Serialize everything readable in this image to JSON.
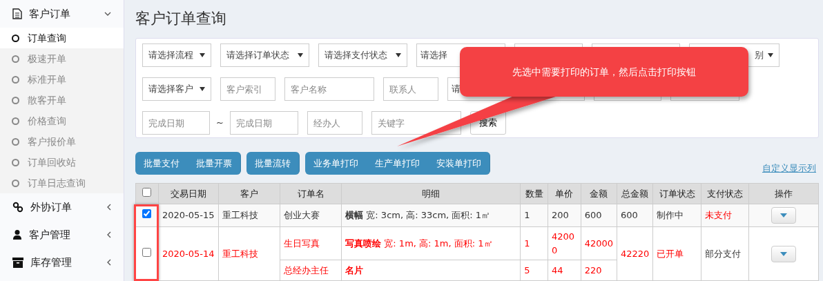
{
  "sidebar": {
    "groups": [
      {
        "label": "客户订单",
        "expanded": true,
        "items": [
          {
            "label": "订单查询",
            "selected": true
          },
          {
            "label": "极速开单",
            "selected": false
          },
          {
            "label": "标准开单",
            "selected": false
          },
          {
            "label": "散客开单",
            "selected": false
          },
          {
            "label": "价格查询",
            "selected": false
          },
          {
            "label": "客户报价单",
            "selected": false
          },
          {
            "label": "订单回收站",
            "selected": false
          },
          {
            "label": "订单日志查询",
            "selected": false
          }
        ]
      },
      {
        "label": "外协订单",
        "expanded": false
      },
      {
        "label": "客户管理",
        "expanded": false
      },
      {
        "label": "库存管理",
        "expanded": false
      }
    ]
  },
  "page_title": "客户订单查询",
  "filters": [
    [
      {
        "kind": "select",
        "text": "请选择流程"
      },
      {
        "kind": "select",
        "text": "请选择订单状态"
      },
      {
        "kind": "select",
        "text": "请选择支付状态"
      },
      {
        "kind": "box",
        "text": "请选择"
      },
      {
        "kind": "box"
      },
      {
        "kind": "box"
      },
      {
        "kind": "tail-select",
        "text": "别"
      }
    ],
    [
      {
        "kind": "select",
        "text": "请选择客户"
      },
      {
        "kind": "input",
        "placeholder": "客户索引"
      },
      {
        "kind": "input",
        "placeholder": "客户名称"
      },
      {
        "kind": "input",
        "placeholder": "联系人"
      },
      {
        "kind": "box",
        "text": "请"
      },
      {
        "kind": "box"
      },
      {
        "kind": "box"
      }
    ],
    [
      {
        "kind": "input",
        "placeholder": "完成日期"
      },
      {
        "kind": "separator",
        "text": "~"
      },
      {
        "kind": "input",
        "placeholder": "完成日期"
      },
      {
        "kind": "input",
        "placeholder": "经办人"
      },
      {
        "kind": "input",
        "placeholder": "关键字"
      },
      {
        "kind": "button",
        "text": "搜索"
      }
    ]
  ],
  "callout": {
    "text": "先选中需要打印的订单，然后点击打印按钮"
  },
  "button_groups": [
    [
      "批量支付",
      "批量开票"
    ],
    [
      "批量流转"
    ],
    [
      "业务单打印",
      "生产单打印",
      "安装单打印"
    ]
  ],
  "custom_columns_link": "自定义显示列",
  "table": {
    "columns": [
      "交易日期",
      "客户",
      "订单名",
      "明细",
      "数量",
      "单价",
      "金额",
      "总金额",
      "订单状态",
      "支付状态",
      "操作"
    ],
    "header_checked": false,
    "rows": [
      {
        "checked": true,
        "highlighted": false,
        "date": "2020-05-15",
        "customer": "重工科技",
        "items": [
          {
            "name": "创业大赛",
            "detail": "**横幅** 宽: 3cm, 高: 33cm, 面积: 1㎡",
            "qty": "1",
            "price": "200",
            "amount": "600"
          }
        ],
        "total": "600",
        "order_status": "制作中",
        "pay_status": "未支付",
        "unpaid": true
      },
      {
        "checked": false,
        "highlighted": true,
        "date": "2020-05-14",
        "customer": "重工科技",
        "items": [
          {
            "name": "生日写真",
            "detail": "**写真喷绘** 宽: 1m, 高: 1m, 面积: 1㎡",
            "qty": "1",
            "price": "42000",
            "amount": "42000"
          },
          {
            "name": "总经办主任",
            "detail": "**名片**",
            "qty": "5",
            "price": "44",
            "amount": "220"
          }
        ],
        "total": "42220",
        "order_status": "已开单",
        "pay_status": "部分支付",
        "unpaid": false
      }
    ]
  }
}
